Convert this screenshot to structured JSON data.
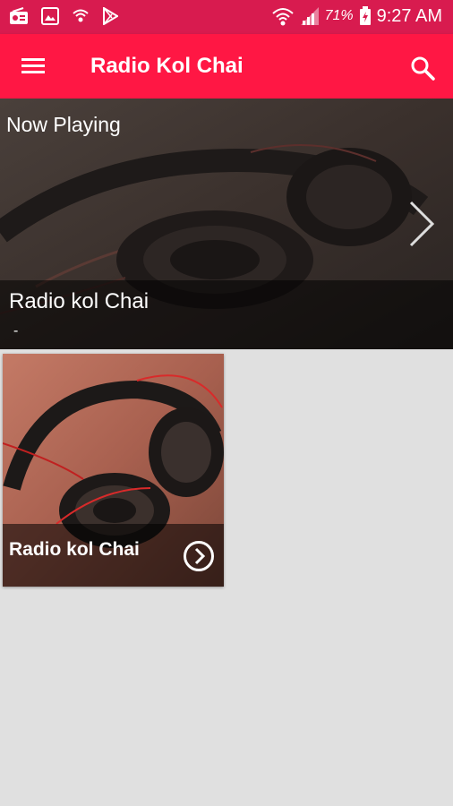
{
  "status_bar": {
    "battery_percent": "71%",
    "time": "9:27 AM",
    "icons": [
      "radio-icon",
      "image-icon",
      "wifi-ring-icon",
      "play-store-icon",
      "wifi-icon",
      "signal-icon",
      "battery-charging-icon"
    ]
  },
  "toolbar": {
    "title": "Radio Kol Chai",
    "menu_icon": "hamburger-menu-icon",
    "search_icon": "search-icon",
    "color": "#ff1744"
  },
  "now_playing": {
    "label": "Now Playing",
    "station": "Radio kol Chai",
    "subtitle": "-",
    "next_icon": "chevron-right-icon"
  },
  "stations": [
    {
      "label": "Radio kol Chai",
      "action_icon": "play-circle-icon"
    }
  ],
  "colors": {
    "status_bar": "#d81b4f",
    "accent": "#ff1744",
    "background": "#e0e0e0"
  }
}
